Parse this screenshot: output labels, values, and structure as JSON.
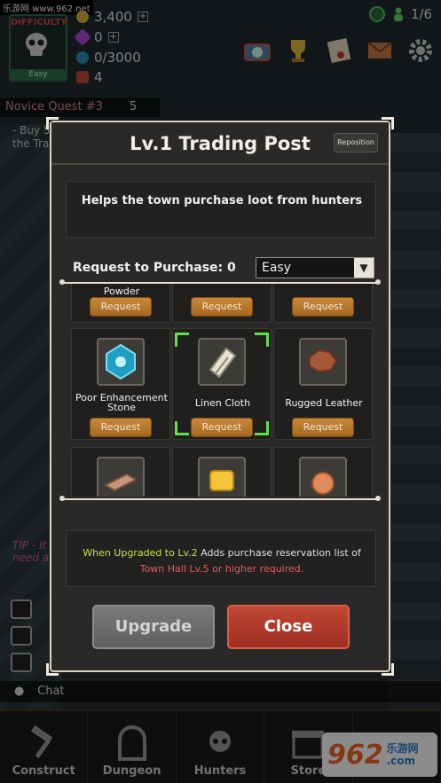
{
  "watermark": "乐游网 www.962.net",
  "hud": {
    "difficulty_label": "DIFFICULTY",
    "difficulty_value": "Easy",
    "gold": "3,400",
    "gems": "0",
    "mana": "0/3000",
    "tickets": "4",
    "population": "1/6"
  },
  "quest": {
    "title": "Novice Quest #3",
    "count": "5",
    "line1": "- Buy 5",
    "line2": "the Tra"
  },
  "tip": "TIP - It",
  "tip2": "need a",
  "chat_label": "Chat",
  "modal": {
    "title": "Lv.1 Trading Post",
    "reposition": "Reposition",
    "description": "Helps the town purchase loot from hunters",
    "request_label": "Request to Purchase: 0",
    "difficulty_select": "Easy",
    "items_row0": [
      {
        "name": "Powder",
        "button": "Request"
      },
      {
        "name": "",
        "button": "Request"
      },
      {
        "name": "",
        "button": "Request"
      }
    ],
    "items_row1": [
      {
        "name": "Poor Enhancement Stone",
        "button": "Request"
      },
      {
        "name": "Linen Cloth",
        "button": "Request"
      },
      {
        "name": "Rugged Leather",
        "button": "Request"
      }
    ],
    "upgrade_note_prefix": "When Upgraded to Lv.2",
    "upgrade_note_suffix": " Adds purchase reservation list of",
    "requirement": "Town Hall Lv.5 or higher required.",
    "upgrade_button": "Upgrade",
    "close_button": "Close"
  },
  "nav": [
    {
      "label": "Construct"
    },
    {
      "label": "Dungeon"
    },
    {
      "label": "Hunters"
    },
    {
      "label": "Store"
    },
    {
      "label": ""
    }
  ],
  "logo": {
    "number": "962",
    "cn": "乐游网",
    "cn2": ".com"
  }
}
